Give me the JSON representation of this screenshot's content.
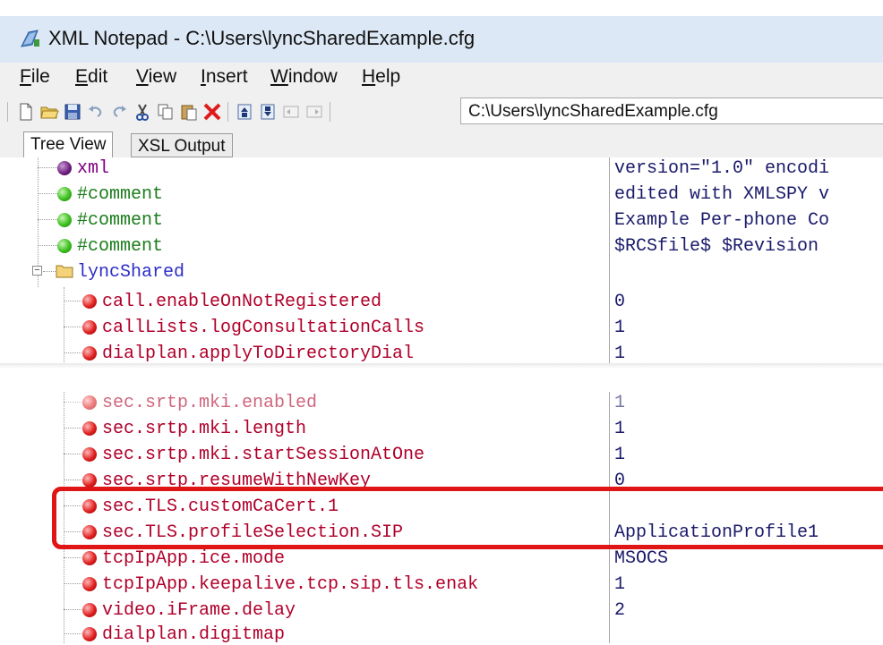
{
  "window": {
    "title": "XML Notepad - C:\\Users\\lyncSharedExample.cfg"
  },
  "menu": [
    {
      "key": "F",
      "rest": "ile"
    },
    {
      "key": "E",
      "rest": "dit"
    },
    {
      "key": "V",
      "rest": "iew"
    },
    {
      "key": "I",
      "rest": "nsert"
    },
    {
      "key": "W",
      "rest": "indow"
    },
    {
      "key": "H",
      "rest": "elp"
    }
  ],
  "toolbar": {
    "path": "C:\\Users\\lyncSharedExample.cfg"
  },
  "tabs": [
    "Tree View",
    "XSL Output"
  ],
  "tree_top": [
    {
      "name": "xml",
      "value": "version=\"1.0\" encodi",
      "icon": "purple"
    },
    {
      "name": "#comment",
      "value": "edited with XMLSPY v",
      "icon": "green"
    },
    {
      "name": "#comment",
      "value": "Example Per-phone Co",
      "icon": "green"
    },
    {
      "name": "#comment",
      "value": "$RCSfile$  $Revision",
      "icon": "green"
    },
    {
      "name": "lyncShared",
      "value": "",
      "icon": "folder"
    },
    {
      "name": "call.enableOnNotRegistered",
      "value": "0",
      "icon": "red"
    },
    {
      "name": "callLists.logConsultationCalls",
      "value": "1",
      "icon": "red"
    },
    {
      "name": "dialplan.applyToDirectoryDial",
      "value": "1",
      "icon": "red"
    }
  ],
  "tree_bottom": [
    {
      "name": "sec.srtp.mki.enabled",
      "value": "1",
      "icon": "red"
    },
    {
      "name": "sec.srtp.mki.length",
      "value": "1",
      "icon": "red"
    },
    {
      "name": "sec.srtp.mki.startSessionAtOne",
      "value": "1",
      "icon": "red"
    },
    {
      "name": "sec.srtp.resumeWithNewKey",
      "value": "0",
      "icon": "red"
    },
    {
      "name": "sec.TLS.customCaCert.1",
      "value": "",
      "icon": "red"
    },
    {
      "name": "sec.TLS.profileSelection.SIP",
      "value": "ApplicationProfile1",
      "icon": "red"
    },
    {
      "name": "tcpIpApp.ice.mode",
      "value": "MSOCS",
      "icon": "red"
    },
    {
      "name": "tcpIpApp.keepalive.tcp.sip.tls.enak",
      "value": "1",
      "icon": "red"
    },
    {
      "name": "video.iFrame.delay",
      "value": "2",
      "icon": "red"
    },
    {
      "name": "dialplan.digitmap",
      "value": "",
      "icon": "red"
    }
  ],
  "icons": {
    "app": "xml-notepad-app-icon",
    "new": "new-file-icon",
    "open": "open-folder-icon",
    "save": "save-disk-icon",
    "undo": "undo-icon",
    "redo": "redo-icon",
    "cut": "cut-scissors-icon",
    "copy": "copy-icon",
    "paste": "paste-icon",
    "delete": "delete-x-icon",
    "nudge_up": "nudge-up-icon",
    "nudge_down": "nudge-down-icon",
    "nudge_left": "nudge-left-icon",
    "nudge_right": "nudge-right-icon"
  },
  "colors": {
    "highlight": "#e01515",
    "titlebar": "#dce8f5",
    "element": "#b0002a",
    "pi": "#800080",
    "comment": "#1a7d1a"
  }
}
